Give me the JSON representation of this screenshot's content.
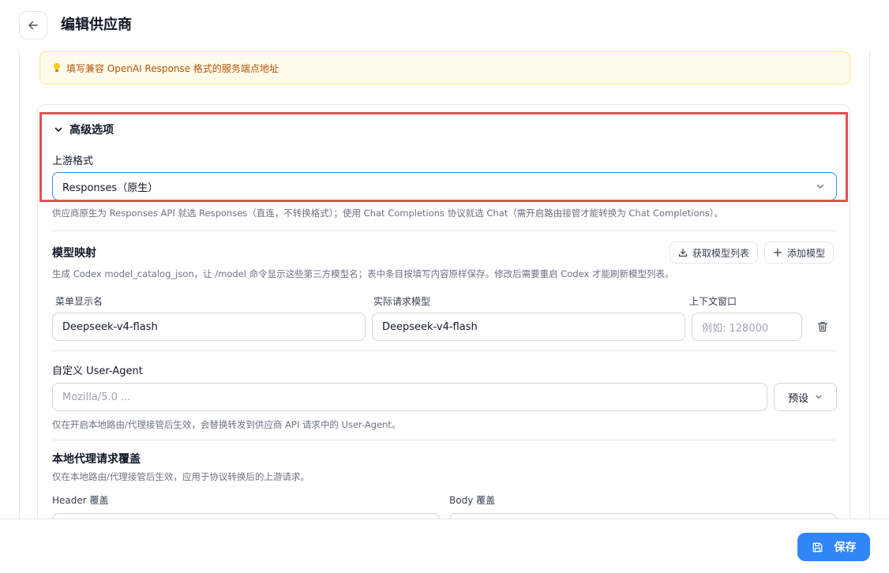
{
  "header": {
    "title": "编辑供应商"
  },
  "notice": {
    "text": "填写兼容 OpenAI Response 格式的服务端点地址"
  },
  "advanced": {
    "toggle_label": "高级选项",
    "upstream_format_label": "上游格式",
    "upstream_format_value": "Responses（原生）",
    "upstream_format_hint": "供应商原生为 Responses API 就选 Responses（直连，不转换格式）；使用 Chat Completions 协议就选 Chat（需开启路由接管才能转换为 Chat Completions）。"
  },
  "model_mapping": {
    "title": "模型映射",
    "fetch_button": "获取模型列表",
    "add_button": "添加模型",
    "hint": "生成 Codex model_catalog_json，让 /model 命令显示这些第三方模型名；表中条目按填写内容原样保存。修改后需要重启 Codex 才能刷新模型列表。",
    "columns": [
      "菜单显示名",
      "实际请求模型",
      "上下文窗口"
    ],
    "rows": [
      {
        "display_name": "Deepseek-v4-flash",
        "request_model": "Deepseek-v4-flash",
        "context_window_placeholder": "例如: 128000"
      }
    ]
  },
  "user_agent": {
    "label": "自定义 User-Agent",
    "placeholder": "Mozilla/5.0 ...",
    "preset_button": "预设",
    "hint": "仅在开启本地路由/代理接管后生效，会替换转发到供应商 API 请求中的 User-Agent。"
  },
  "override": {
    "title": "本地代理请求覆盖",
    "hint": "仅在本地路由/代理接管后生效，应用于协议转换后的上游请求。",
    "header_label": "Header 覆盖",
    "body_label": "Body 覆盖"
  },
  "footer": {
    "save_label": "保存"
  },
  "colors": {
    "accent": "#2f86f6",
    "highlight": "#e15252",
    "notice_bg": "#fffbea",
    "notice_text": "#b45309"
  }
}
